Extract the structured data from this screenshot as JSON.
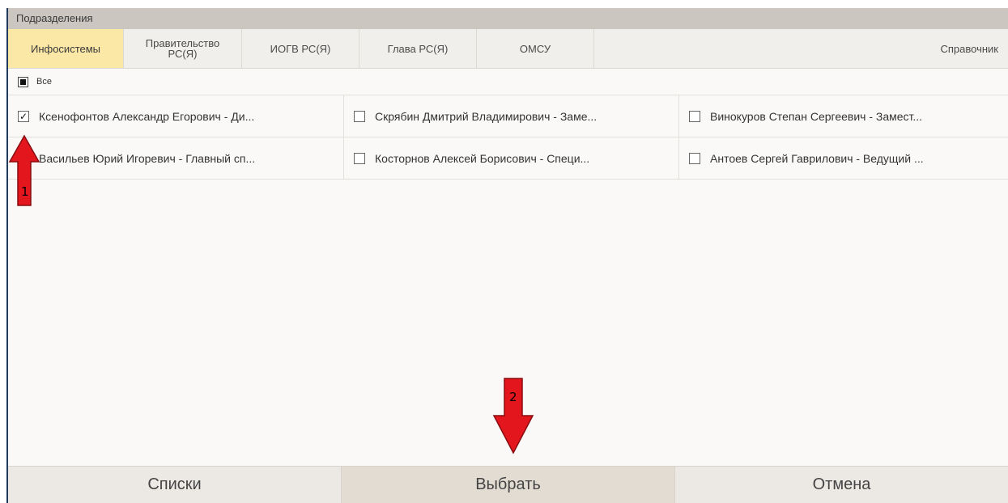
{
  "dialog": {
    "title": "Подразделения"
  },
  "tabs": [
    {
      "label": "Инфосистемы",
      "active": true
    },
    {
      "label": "Правительство РС(Я)",
      "active": false
    },
    {
      "label": "ИОГВ РС(Я)",
      "active": false
    },
    {
      "label": "Глава РС(Я)",
      "active": false
    },
    {
      "label": "ОМСУ",
      "active": false
    },
    {
      "label": "Справочник",
      "active": false
    }
  ],
  "select_all": {
    "label": "Все",
    "state": "partial"
  },
  "rows": [
    [
      {
        "label": "Ксенофонтов Александр Егорович - Ди...",
        "checked": true
      },
      {
        "label": "Скрябин Дмитрий Владимирович - Заме...",
        "checked": false
      },
      {
        "label": "Винокуров Степан Сергеевич - Замест...",
        "checked": false
      }
    ],
    [
      {
        "label": "Васильев Юрий Игоревич - Главный сп...",
        "checked": false
      },
      {
        "label": "Косторнов Алексей Борисович - Специ...",
        "checked": false
      },
      {
        "label": "Антоев Сергей Гаврилович - Ведущий ...",
        "checked": false
      }
    ]
  ],
  "footer": {
    "lists_label": "Списки",
    "select_label": "Выбрать",
    "cancel_label": "Отмена"
  },
  "annotations": [
    {
      "number": "1",
      "direction": "up"
    },
    {
      "number": "2",
      "direction": "down"
    }
  ],
  "colors": {
    "active_tab": "#fbe7a6",
    "titlebar": "#cbc6bf",
    "arrow": "#e3161d"
  }
}
